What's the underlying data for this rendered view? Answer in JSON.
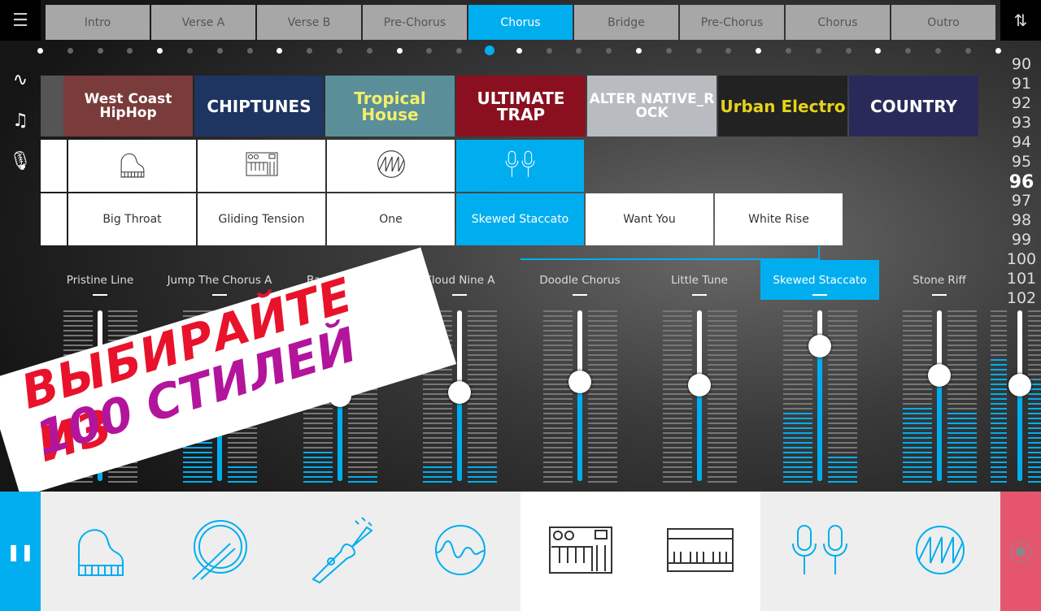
{
  "sections": [
    "Intro",
    "Verse A",
    "Verse B",
    "Pre-Chorus",
    "Chorus",
    "Bridge",
    "Pre-Chorus",
    "Chorus",
    "Outro"
  ],
  "active_section": 4,
  "genres": [
    {
      "label": "West Coast HipHop",
      "bg": "#7a3b3b",
      "color": "#fff"
    },
    {
      "label": "CHIPTUNES",
      "bg": "#1d3560",
      "color": "#fff"
    },
    {
      "label": "Tropical House",
      "bg": "#5a8f9a",
      "color": "#f4ef6a"
    },
    {
      "label": "ULTIMATE TRAP",
      "bg": "#8a1020",
      "color": "#fff"
    },
    {
      "label": "ALTER NATIVE_R OCK",
      "bg": "#b8bcc0",
      "color": "#fff"
    },
    {
      "label": "Urban Electro",
      "bg": "#222",
      "color": "#e6d21b"
    },
    {
      "label": "COUNTRY",
      "bg": "#2a2a5a",
      "color": "#fff"
    }
  ],
  "instruments": [
    "piano-icon",
    "synth-icon",
    "saw-wave-icon",
    "microphones-icon"
  ],
  "selected_instrument": 3,
  "presets": [
    "Big Throat",
    "Gliding Tension",
    "One",
    "Skewed Staccato",
    "Want You",
    "White Rise"
  ],
  "selected_preset": 3,
  "bpm": [
    "90",
    "91",
    "92",
    "93",
    "94",
    "95",
    "96",
    "97",
    "98",
    "99",
    "100",
    "101",
    "102"
  ],
  "current_bpm": "96",
  "faders": [
    {
      "label": "Pristine Line",
      "level": 0.57,
      "meter_l": 0,
      "meter_r": 0
    },
    {
      "label": "Jump The Chorus A",
      "level": 0.88,
      "meter_l": 0.78,
      "meter_r": 0.1
    },
    {
      "label": "Bass Leap C",
      "level": 0.5,
      "meter_l": 0.2,
      "meter_r": 0.05
    },
    {
      "label": "Cloud Nine  A",
      "level": 0.52,
      "meter_l": 0.1,
      "meter_r": 0.1
    },
    {
      "label": "Doodle Chorus",
      "level": 0.58,
      "meter_l": 0,
      "meter_r": 0
    },
    {
      "label": "Little Tune",
      "level": 0.56,
      "meter_l": 0,
      "meter_r": 0
    },
    {
      "label": "Skewed Staccato",
      "level": 0.79,
      "meter_l": 0.42,
      "meter_r": 0.15
    },
    {
      "label": "Stone Riff",
      "level": 0.62,
      "meter_l": 0.45,
      "meter_r": 0.42
    },
    {
      "label": "",
      "level": 0.56,
      "meter_l": 0.72,
      "meter_r": 0.6
    }
  ],
  "selected_fader": 6,
  "banner": {
    "line1": "ВЫБИРАЙТЕ ИЗ",
    "line2": "100 СТИЛЕЙ"
  },
  "bottom_instruments": [
    "piano-icon",
    "drum-icon",
    "bass-guitar-icon",
    "wave-icon",
    "synth-icon",
    "keyboard-icon",
    "microphones-icon",
    "saw-wave-icon"
  ],
  "colors": {
    "accent": "#00aeef",
    "record": "#e5566e"
  }
}
